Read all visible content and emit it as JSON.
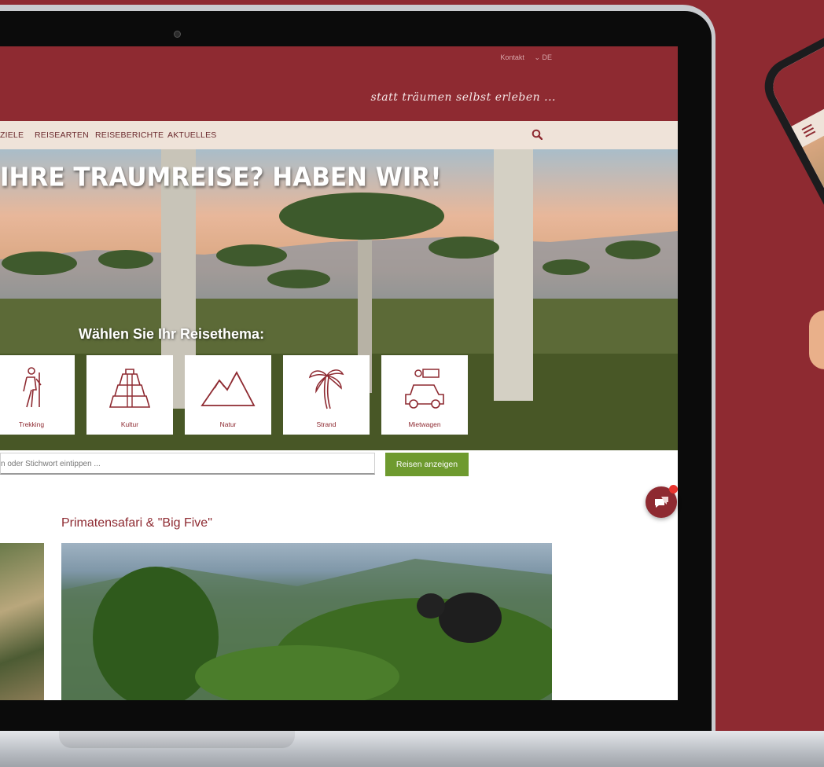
{
  "site": {
    "top_links": [
      "Kontakt",
      "⌄ DE"
    ],
    "slogan": "statt träumen selbst erleben ...",
    "nav": [
      "ZIELE",
      "REISEARTEN",
      "REISEBERICHTE",
      "AKTUELLES"
    ],
    "hero_title": "IHRE TRAUMREISE? HABEN WIR!",
    "hero_subtitle": "Wählen Sie Ihr Reisethema:",
    "themes": [
      {
        "label": "Trekking",
        "icon": "hiker-icon"
      },
      {
        "label": "Kultur",
        "icon": "pyramid-icon"
      },
      {
        "label": "Natur",
        "icon": "mountains-icon"
      },
      {
        "label": "Strand",
        "icon": "palm-tree-icon"
      },
      {
        "label": "Mietwagen",
        "icon": "rental-car-icon"
      }
    ],
    "search": {
      "placeholder": "n oder Stichwort eintippen ...",
      "button": "Reisen anzeigen"
    },
    "featured_title": "Primatensafari & \"Big Five\""
  },
  "colors": {
    "brand": "#8e2a31",
    "nav_bg": "#efe3d9",
    "button": "#6e9a2f"
  }
}
